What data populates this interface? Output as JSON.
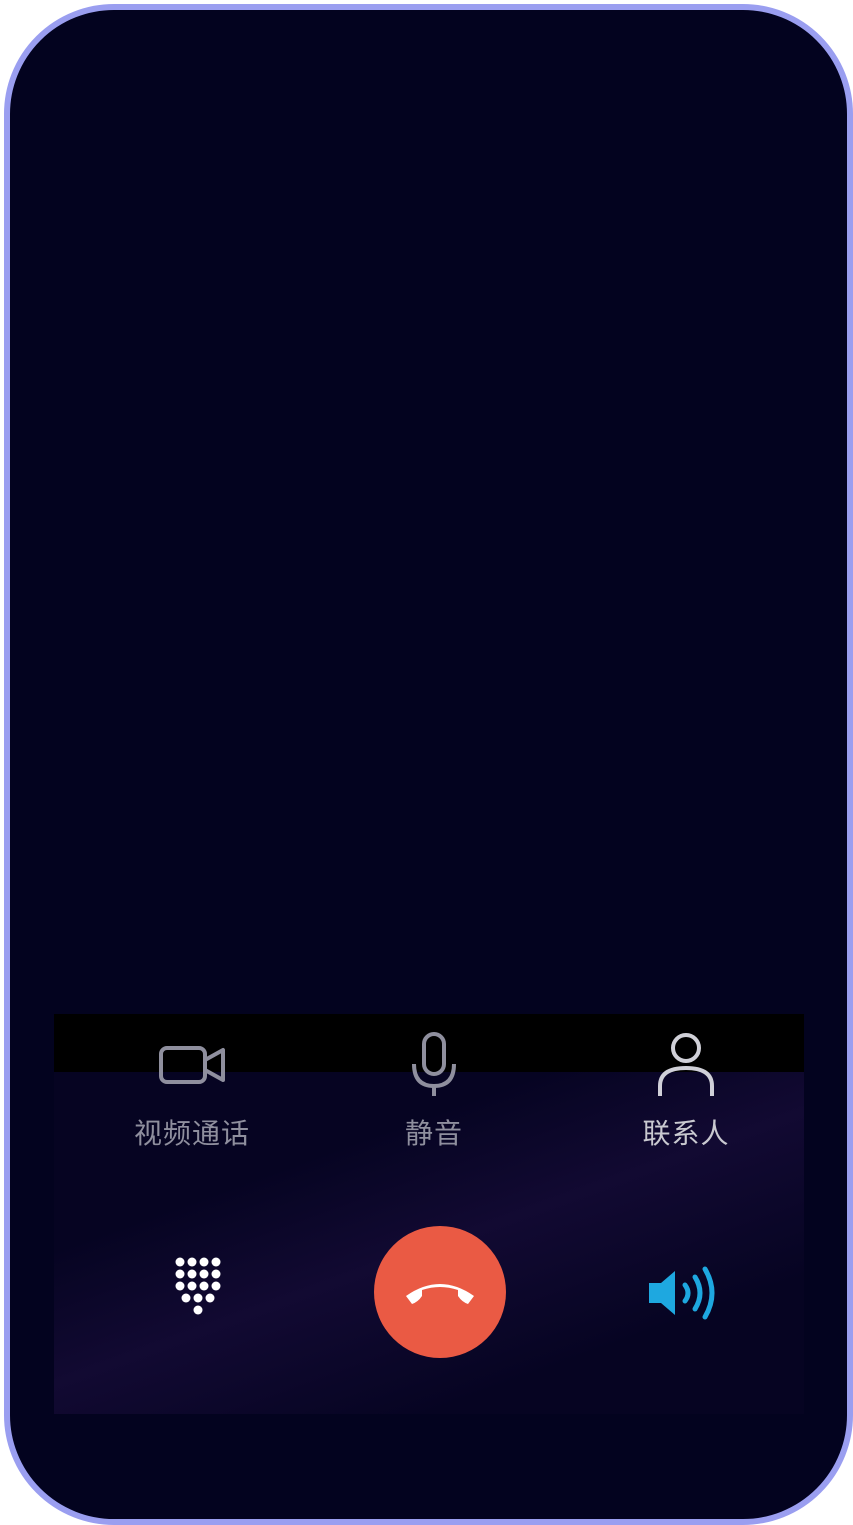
{
  "call_screen": {
    "actions": [
      {
        "label": "视频通话",
        "icon": "video-camera-icon"
      },
      {
        "label": "静音",
        "icon": "microphone-icon"
      },
      {
        "label": "联系人",
        "icon": "person-icon"
      }
    ],
    "bottom_controls": [
      {
        "icon": "dialpad-icon"
      },
      {
        "icon": "end-call-icon",
        "color": "#ea5a44"
      },
      {
        "icon": "speaker-icon",
        "color": "#1ea8e0",
        "state": "active"
      }
    ]
  },
  "colors": {
    "background": "#03031f",
    "frame_border": "#9a9ef0",
    "label_text": "#8f8f9e"
  }
}
